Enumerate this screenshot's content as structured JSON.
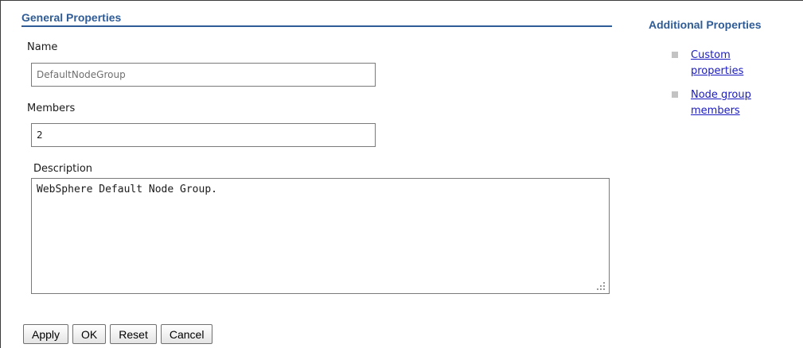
{
  "general_properties": {
    "title": "General Properties",
    "name_label": "Name",
    "name_value": "DefaultNodeGroup",
    "members_label": "Members",
    "members_value": "2",
    "description_label": "Description",
    "description_value": "WebSphere Default Node Group."
  },
  "additional_properties": {
    "title": "Additional Properties",
    "links": [
      {
        "label": "Custom properties"
      },
      {
        "label": "Node group members"
      }
    ]
  },
  "buttons": {
    "apply": "Apply",
    "ok": "OK",
    "reset": "Reset",
    "cancel": "Cancel"
  },
  "colors": {
    "section_title": "#2f5c96",
    "link": "#1a1abf",
    "bullet": "#c3c3c3"
  }
}
